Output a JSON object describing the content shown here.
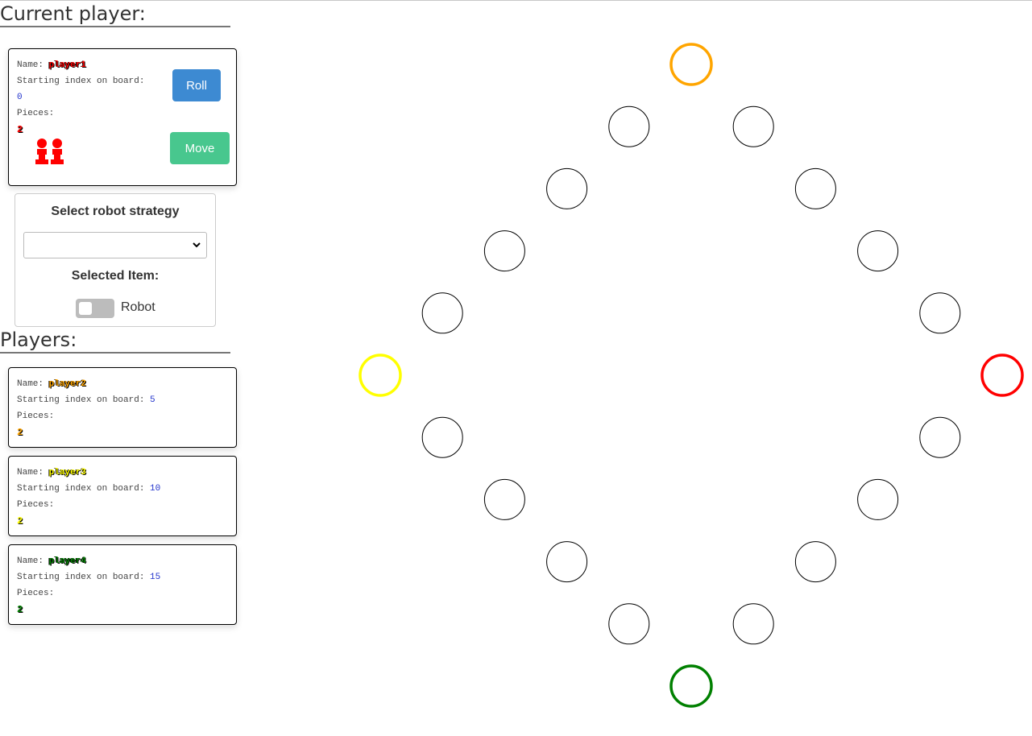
{
  "current_section": {
    "heading": "Current player:",
    "player": {
      "name_label": "Name:",
      "name": "player1",
      "color": "#ff0000",
      "start_label": "Starting index on board:",
      "start_index": "0",
      "pieces_label": "Pieces:",
      "pieces": "2",
      "roll_label": "Roll",
      "move_label": "Move"
    }
  },
  "robot": {
    "title": "Select robot strategy",
    "selected_value": "",
    "selected_item_label": "Selected Item:",
    "toggle_label": "Robot",
    "toggle_on": false
  },
  "players_section": {
    "heading": "Players:",
    "players": [
      {
        "name_label": "Name:",
        "name": "player2",
        "color": "#ffa500",
        "start_label": "Starting index on board:",
        "start_index": "5",
        "pieces_label": "Pieces:",
        "pieces": "2"
      },
      {
        "name_label": "Name:",
        "name": "player3",
        "color": "#ffff00",
        "start_label": "Starting index on board:",
        "start_index": "10",
        "pieces_label": "Pieces:",
        "pieces": "2"
      },
      {
        "name_label": "Name:",
        "name": "player4",
        "color": "#008000",
        "start_label": "Starting index on board:",
        "start_index": "15",
        "pieces_label": "Pieces:",
        "pieces": "2"
      }
    ]
  },
  "board": {
    "field_count": 20,
    "start_fields": [
      {
        "index": 0,
        "color": "#ff0000"
      },
      {
        "index": 5,
        "color": "#ffa500"
      },
      {
        "index": 10,
        "color": "#ffff00"
      },
      {
        "index": 15,
        "color": "#008000"
      }
    ]
  }
}
